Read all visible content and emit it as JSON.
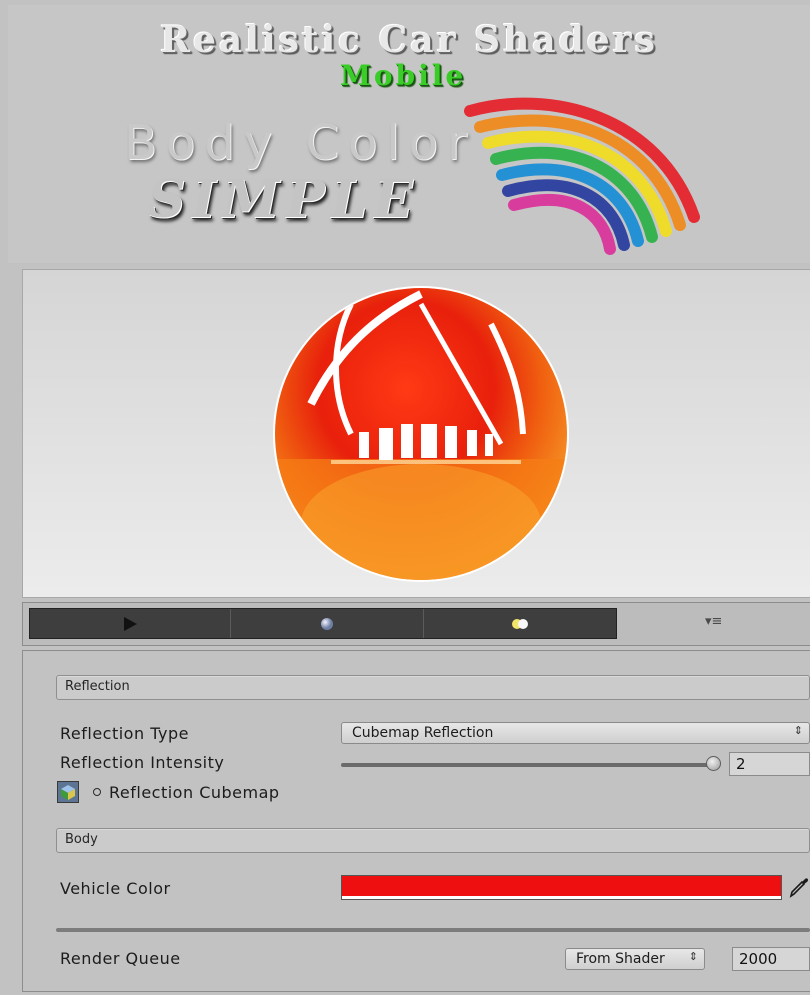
{
  "banner": {
    "title": "Realistic Car Shaders",
    "subtitle": "Mobile",
    "heading": "Body Color",
    "badge": "SIMPLE"
  },
  "preview": {
    "sphere_color": "#e82a10",
    "tabs": [
      {
        "icon": "play-icon"
      },
      {
        "icon": "light-sphere-icon"
      },
      {
        "icon": "dual-light-icon"
      }
    ],
    "settings_icon": "dropdown-menu-icon",
    "settings_glyph": "▾≡"
  },
  "inspector": {
    "reflection_section": "Reflection",
    "reflection_type": {
      "label": "Reflection Type",
      "value": "Cubemap Reflection",
      "arrow": "⇕"
    },
    "reflection_intensity": {
      "label": "Reflection Intensity",
      "value": "2",
      "slider_fraction": 1.0
    },
    "reflection_cubemap": {
      "label": "Reflection Cubemap"
    },
    "body_section": "Body",
    "vehicle_color": {
      "label": "Vehicle Color",
      "value": "#ee1010"
    },
    "render_queue": {
      "label": "Render Queue",
      "mode": "From Shader",
      "arrow": "⇕",
      "value": "2000"
    }
  }
}
